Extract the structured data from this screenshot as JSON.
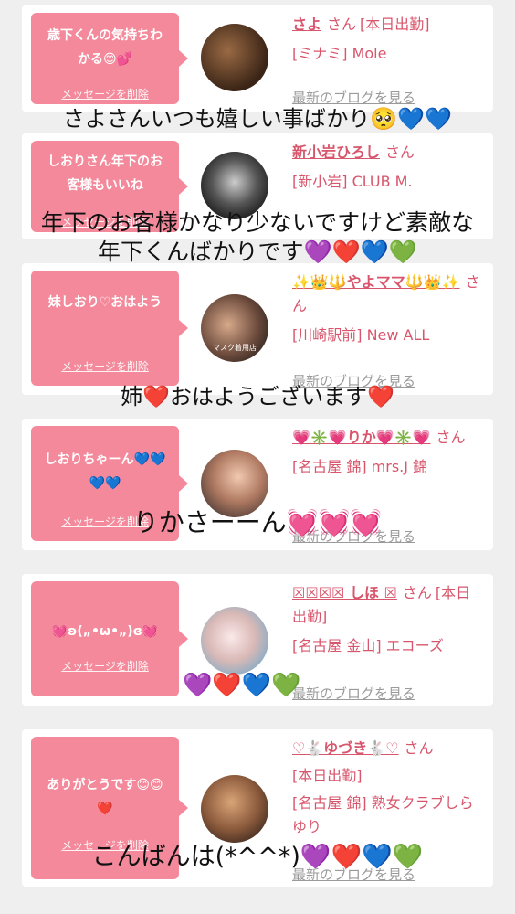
{
  "cards": [
    {
      "message": "歳下くんの気持ちわかる😊💕",
      "delete_label": "メッセージを削除",
      "name": "さよ",
      "san": "さん",
      "status": "[本日出勤]",
      "shop": "[ミナミ] Mole",
      "blog": "最新のブログを見る"
    },
    {
      "message": "しおりさん年下のお客様もいいね",
      "delete_label": "メッセージを削除",
      "name": "新小岩ひろし",
      "san": "さん",
      "status": "",
      "shop": "[新小岩] CLUB M.",
      "blog": "最新のブログを見る"
    },
    {
      "message": "妹しおり♡おはよう",
      "delete_label": "メッセージを削除",
      "name": "✨👑🔱やよママ🔱👑✨",
      "san": "さん",
      "status": "",
      "shop": "[川崎駅前] New ALL",
      "blog": "最新のブログを見る"
    },
    {
      "message": "しおりちゃーん💙💙💙💙",
      "delete_label": "メッセージを削除",
      "name": "💗✳️💗りか💗✳️💗",
      "san": "さん",
      "status": "",
      "shop": "[名古屋 錦] mrs.J 錦",
      "blog": "最新のブログを見る"
    },
    {
      "message": "💓ʚ(„•ω•„)ɞ💓",
      "delete_label": "メッセージを削除",
      "name": "☒☒☒☒ しほ ☒",
      "san": "さん",
      "status": "[本日出勤]",
      "shop": "[名古屋 金山] エコーズ",
      "blog": "最新のブログを見る"
    },
    {
      "message": "ありがとうです😊😊❤️",
      "delete_label": "メッセージを削除",
      "name": "♡🐇ゆづき🐇♡",
      "san": "さん",
      "status": "[本日出勤]",
      "shop": "[名古屋 錦] 熟女クラブしらゆり",
      "blog": "最新のブログを見る"
    }
  ],
  "overlays": [
    "さよさんいつも嬉しい事ばかり🥺💙💙",
    "年下のお客様かなり少ないですけど素敵な",
    "年下くんばかりです💜❤️💙💚",
    "姉❤️おはようございます❤️",
    "りかさーーん💓💓💓",
    "💜❤️💙💚",
    "こんばんは(*^^*)💜❤️💙💚"
  ],
  "avatar_badge": "マスク着用店"
}
